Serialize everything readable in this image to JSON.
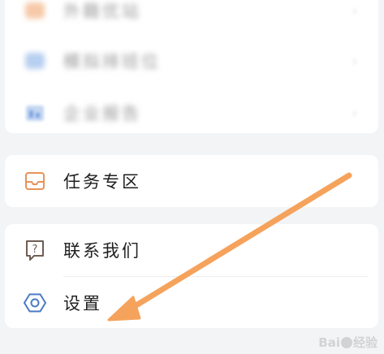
{
  "menu_top": {
    "items": [
      {
        "label": "外籍优站",
        "icon": "blurred-orange-icon",
        "blurred": true
      },
      {
        "label": "模拟排班位",
        "icon": "blurred-blue-icon",
        "blurred": true
      },
      {
        "label": "企业报告",
        "icon": "report-icon",
        "blurred": true
      }
    ]
  },
  "tasks": {
    "label": "任务专区",
    "icon": "inbox-icon"
  },
  "menu_bottom": {
    "contact": {
      "label": "联系我们",
      "icon": "question-icon"
    },
    "settings": {
      "label": "设置",
      "icon": "settings-hexagon-icon"
    }
  },
  "chevron": "›",
  "annotation": {
    "color": "#F5A35C"
  },
  "watermark": {
    "brand_left": "Bai",
    "brand_right": "经验"
  },
  "colors": {
    "background": "#F3F4F6",
    "card": "#FFFFFF",
    "icon_orange": "#E7935A",
    "icon_blue": "#5B8FD6",
    "icon_dark": "#6E5E55",
    "settings_icon": "#4A7BC4"
  }
}
